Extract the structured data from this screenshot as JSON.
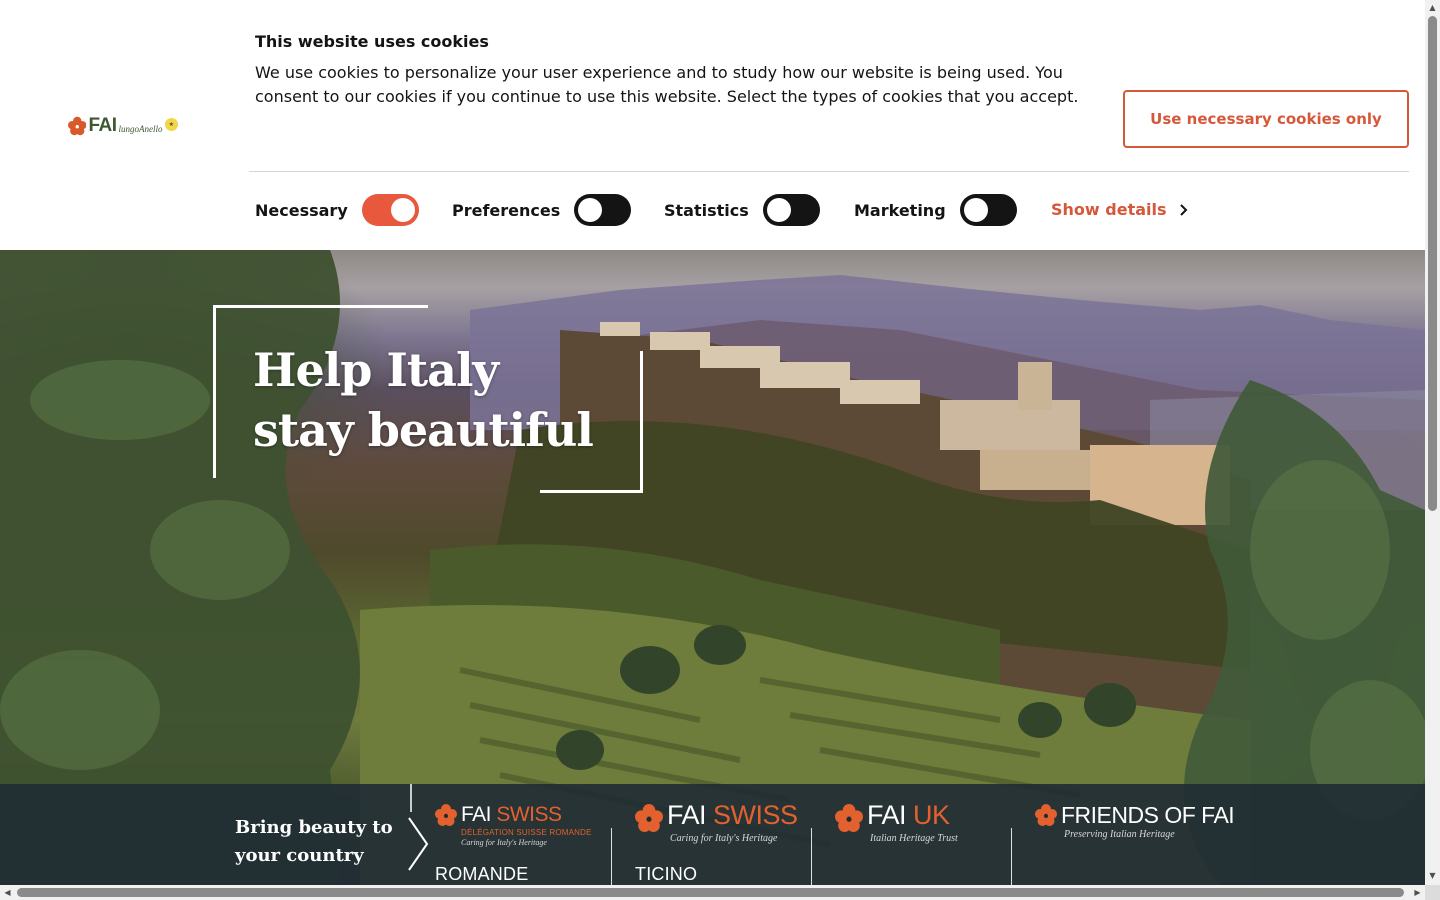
{
  "cookie_banner": {
    "title": "This website uses cookies",
    "text": "We use cookies to personalize your user experience and to study how our website is being used. You consent to our cookies if you continue to use this website. Select the types of cookies that you accept.",
    "necessary_button": "Use necessary cookies only",
    "toggles": [
      {
        "label": "Necessary",
        "on": true
      },
      {
        "label": "Preferences",
        "on": false
      },
      {
        "label": "Statistics",
        "on": false
      },
      {
        "label": "Marketing",
        "on": false
      }
    ],
    "show_details": "Show details",
    "colors": {
      "accent": "#d6583a",
      "toggle_on": "#e8583d",
      "toggle_off": "#141414"
    }
  },
  "logo": {
    "text": "FAI",
    "script": "lungoAnello"
  },
  "hero": {
    "headline_line1": "Help Italy",
    "headline_line2": "stay beautiful"
  },
  "country_strip": {
    "title": "Bring beauty to your country",
    "orgs": [
      {
        "name": "FAI",
        "accent": "SWISS",
        "tagline": "Caring for Italy's Heritage",
        "subline": "DÉLÉGATION SUISSE ROMANDE",
        "label": "ROMANDE"
      },
      {
        "name": "FAI",
        "accent": "SWISS",
        "tagline": "Caring for Italy's Heritage",
        "label": "TICINO"
      },
      {
        "name": "FAI",
        "accent": "UK",
        "tagline": "Italian Heritage Trust",
        "label": ""
      },
      {
        "name": "FRIENDS OF FAI",
        "accent": "",
        "tagline": "Preserving Italian Heritage",
        "label": ""
      }
    ],
    "colors": {
      "background": "#1f2b34",
      "accent": "#e2612e"
    }
  },
  "icons": {
    "flower": "fai-flower-icon",
    "chevron": "chevron-right-icon",
    "arrow": "arrow-right-icon"
  }
}
